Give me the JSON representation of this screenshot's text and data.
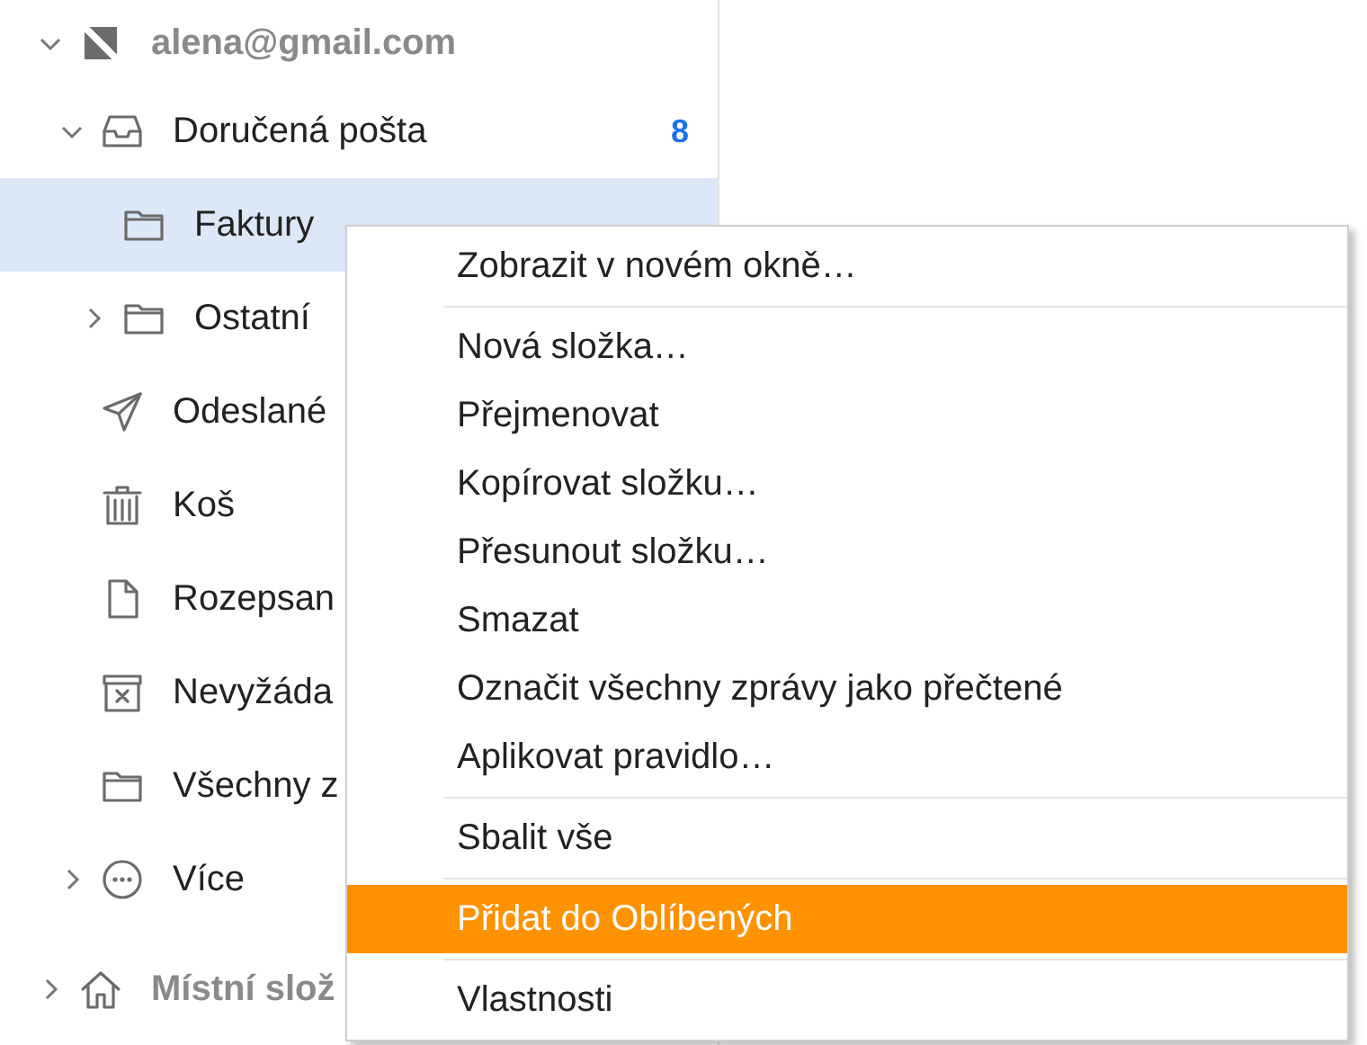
{
  "folder_tree": [
    {
      "name": "alena@gmail.com",
      "kind": "account",
      "expanded": true,
      "selected": false,
      "children": [
        {
          "name": "Doručená pošta",
          "kind": "inbox",
          "expanded": true,
          "selected": false,
          "count": "8",
          "children": [
            {
              "name": "Faktury",
              "kind": "folder",
              "selected": true
            },
            {
              "name": "Ostatní",
              "kind": "folder",
              "expanded": false,
              "selected": false
            }
          ]
        },
        {
          "name": "Odeslané",
          "kind": "sent",
          "selected": false
        },
        {
          "name": "Koš",
          "kind": "trash",
          "selected": false
        },
        {
          "name": "Rozepsan",
          "kind": "draft",
          "selected": false
        },
        {
          "name": "Nevyžáda",
          "kind": "junk",
          "selected": false
        },
        {
          "name": "Všechny z",
          "kind": "folder",
          "selected": false
        },
        {
          "name": "Více",
          "kind": "more",
          "expanded": false,
          "selected": false
        }
      ]
    },
    {
      "name": "Místní slož",
      "kind": "home",
      "expanded": false,
      "selected": false
    }
  ],
  "context_menu": {
    "groups": [
      [
        {
          "label": "Zobrazit v novém okně…",
          "selected": false
        }
      ],
      [
        {
          "label": "Nová složka…",
          "selected": false
        },
        {
          "label": "Přejmenovat",
          "selected": false
        },
        {
          "label": "Kopírovat složku…",
          "selected": false
        },
        {
          "label": "Přesunout složku…",
          "selected": false
        },
        {
          "label": "Smazat",
          "selected": false
        },
        {
          "label": "Označit všechny zprávy jako přečtené",
          "selected": false
        },
        {
          "label": "Aplikovat pravidlo…",
          "selected": false
        }
      ],
      [
        {
          "label": "Sbalit vše",
          "selected": false
        }
      ],
      [
        {
          "label": "Přidat do Oblíbených",
          "selected": true
        }
      ],
      [
        {
          "label": "Vlastnosti",
          "selected": false
        }
      ]
    ]
  }
}
